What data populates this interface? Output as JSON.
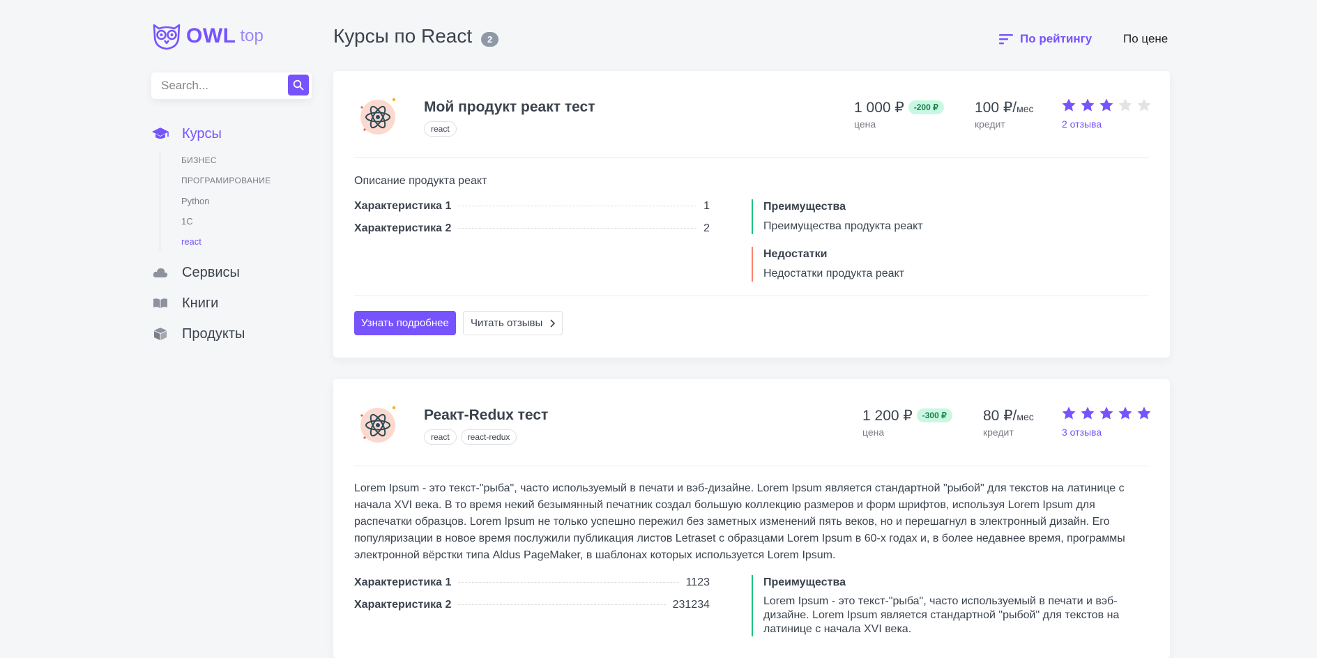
{
  "brand": {
    "name": "OWL",
    "suffix": "top"
  },
  "search": {
    "placeholder": "Search..."
  },
  "menu": {
    "courses": "Курсы",
    "services": "Сервисы",
    "books": "Книги",
    "products": "Продукты",
    "sub": [
      "БИЗНЕС",
      "ПРОГРАМИРОВАНИЕ",
      "Python",
      "1С",
      "react"
    ]
  },
  "header": {
    "title": "Курсы по React",
    "count": "2",
    "sort_rating": "По рейтингу",
    "sort_price": "По цене"
  },
  "accent": "#7653fc",
  "products": [
    {
      "title": "Мой продукт реакт тест",
      "tags": [
        "react"
      ],
      "price": "1 000 ₽",
      "discount": "-200 ₽",
      "price_label": "цена",
      "credit": "100 ₽/",
      "credit_unit": "мес",
      "credit_label": "кредит",
      "rating": 3,
      "reviews": "2 отзыва",
      "description": "Описание продукта реакт",
      "chars": [
        {
          "name": "Характеристика 1",
          "value": "1"
        },
        {
          "name": "Характеристика 2",
          "value": "2"
        }
      ],
      "adv_title": "Преимущества",
      "adv_text": "Преимущества продукта реакт",
      "disadv_title": "Недостатки",
      "disadv_text": "Недостатки продукта реакт",
      "btn_more": "Узнать подробнее",
      "btn_reviews": "Читать отзывы"
    },
    {
      "title": "Реакт-Redux тест",
      "tags": [
        "react",
        "react-redux"
      ],
      "price": "1 200 ₽",
      "discount": "-300 ₽",
      "price_label": "цена",
      "credit": "80 ₽/",
      "credit_unit": "мес",
      "credit_label": "кредит",
      "rating": 5,
      "reviews": "3 отзыва",
      "description": "Lorem Ipsum - это текст-\"рыба\", часто используемый в печати и вэб-дизайне. Lorem Ipsum является стандартной \"рыбой\" для текстов на латинице с начала XVI века. В то время некий безымянный печатник создал большую коллекцию размеров и форм шрифтов, используя Lorem Ipsum для распечатки образцов. Lorem Ipsum не только успешно пережил без заметных изменений пять веков, но и перешагнул в электронный дизайн. Его популяризации в новое время послужили публикация листов Letraset с образцами Lorem Ipsum в 60-х годах и, в более недавнее время, программы электронной вёрстки типа Aldus PageMaker, в шаблонах которых используется Lorem Ipsum.",
      "chars": [
        {
          "name": "Характеристика 1",
          "value": "1123"
        },
        {
          "name": "Характеристика 2",
          "value": "231234"
        }
      ],
      "adv_title": "Преимущества",
      "adv_text": "Lorem Ipsum - это текст-\"рыба\", часто используемый в печати и вэб-дизайне. Lorem Ipsum является стандартной \"рыбой\" для текстов на латинице с начала XVI века."
    }
  ]
}
